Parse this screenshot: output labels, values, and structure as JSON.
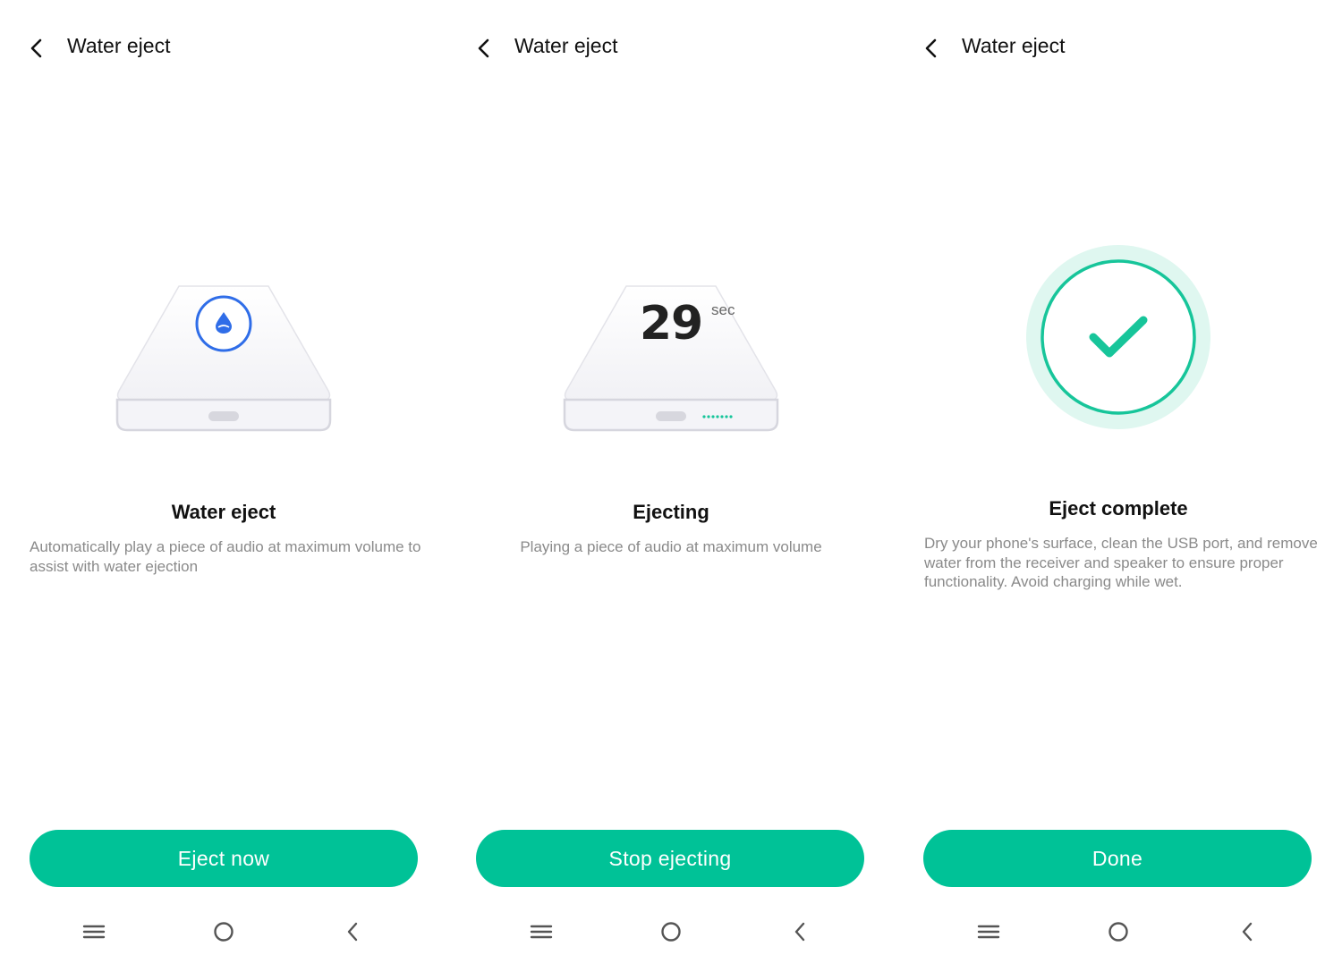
{
  "colors": {
    "accent": "#00c297",
    "ring_blue": "#2f6de8",
    "check_green": "#17c59a",
    "halo": "#dff7f0",
    "secondary_text": "#8a8a8a"
  },
  "screens": [
    {
      "header": {
        "title": "Water eject",
        "back_icon": "chevron-left-icon"
      },
      "illustration": {
        "icon": "water-drop-icon"
      },
      "title": "Water eject",
      "description": "Automatically play a piece of audio at maximum volume to assist with water ejection",
      "button": "Eject now"
    },
    {
      "header": {
        "title": "Water eject",
        "back_icon": "chevron-left-icon"
      },
      "illustration": {
        "countdown": "29",
        "unit": "sec"
      },
      "title": "Ejecting",
      "description": "Playing a piece of audio at maximum volume",
      "button": "Stop ejecting"
    },
    {
      "header": {
        "title": "Water eject",
        "back_icon": "chevron-left-icon"
      },
      "illustration": {
        "icon": "checkmark-icon"
      },
      "title": "Eject complete",
      "description": "Dry your phone's surface, clean the USB port, and remove water from the receiver and speaker to ensure proper functionality. Avoid charging while wet.",
      "button": "Done"
    }
  ],
  "navbar": {
    "icons": [
      "menu-icon",
      "home-icon",
      "back-icon"
    ]
  }
}
